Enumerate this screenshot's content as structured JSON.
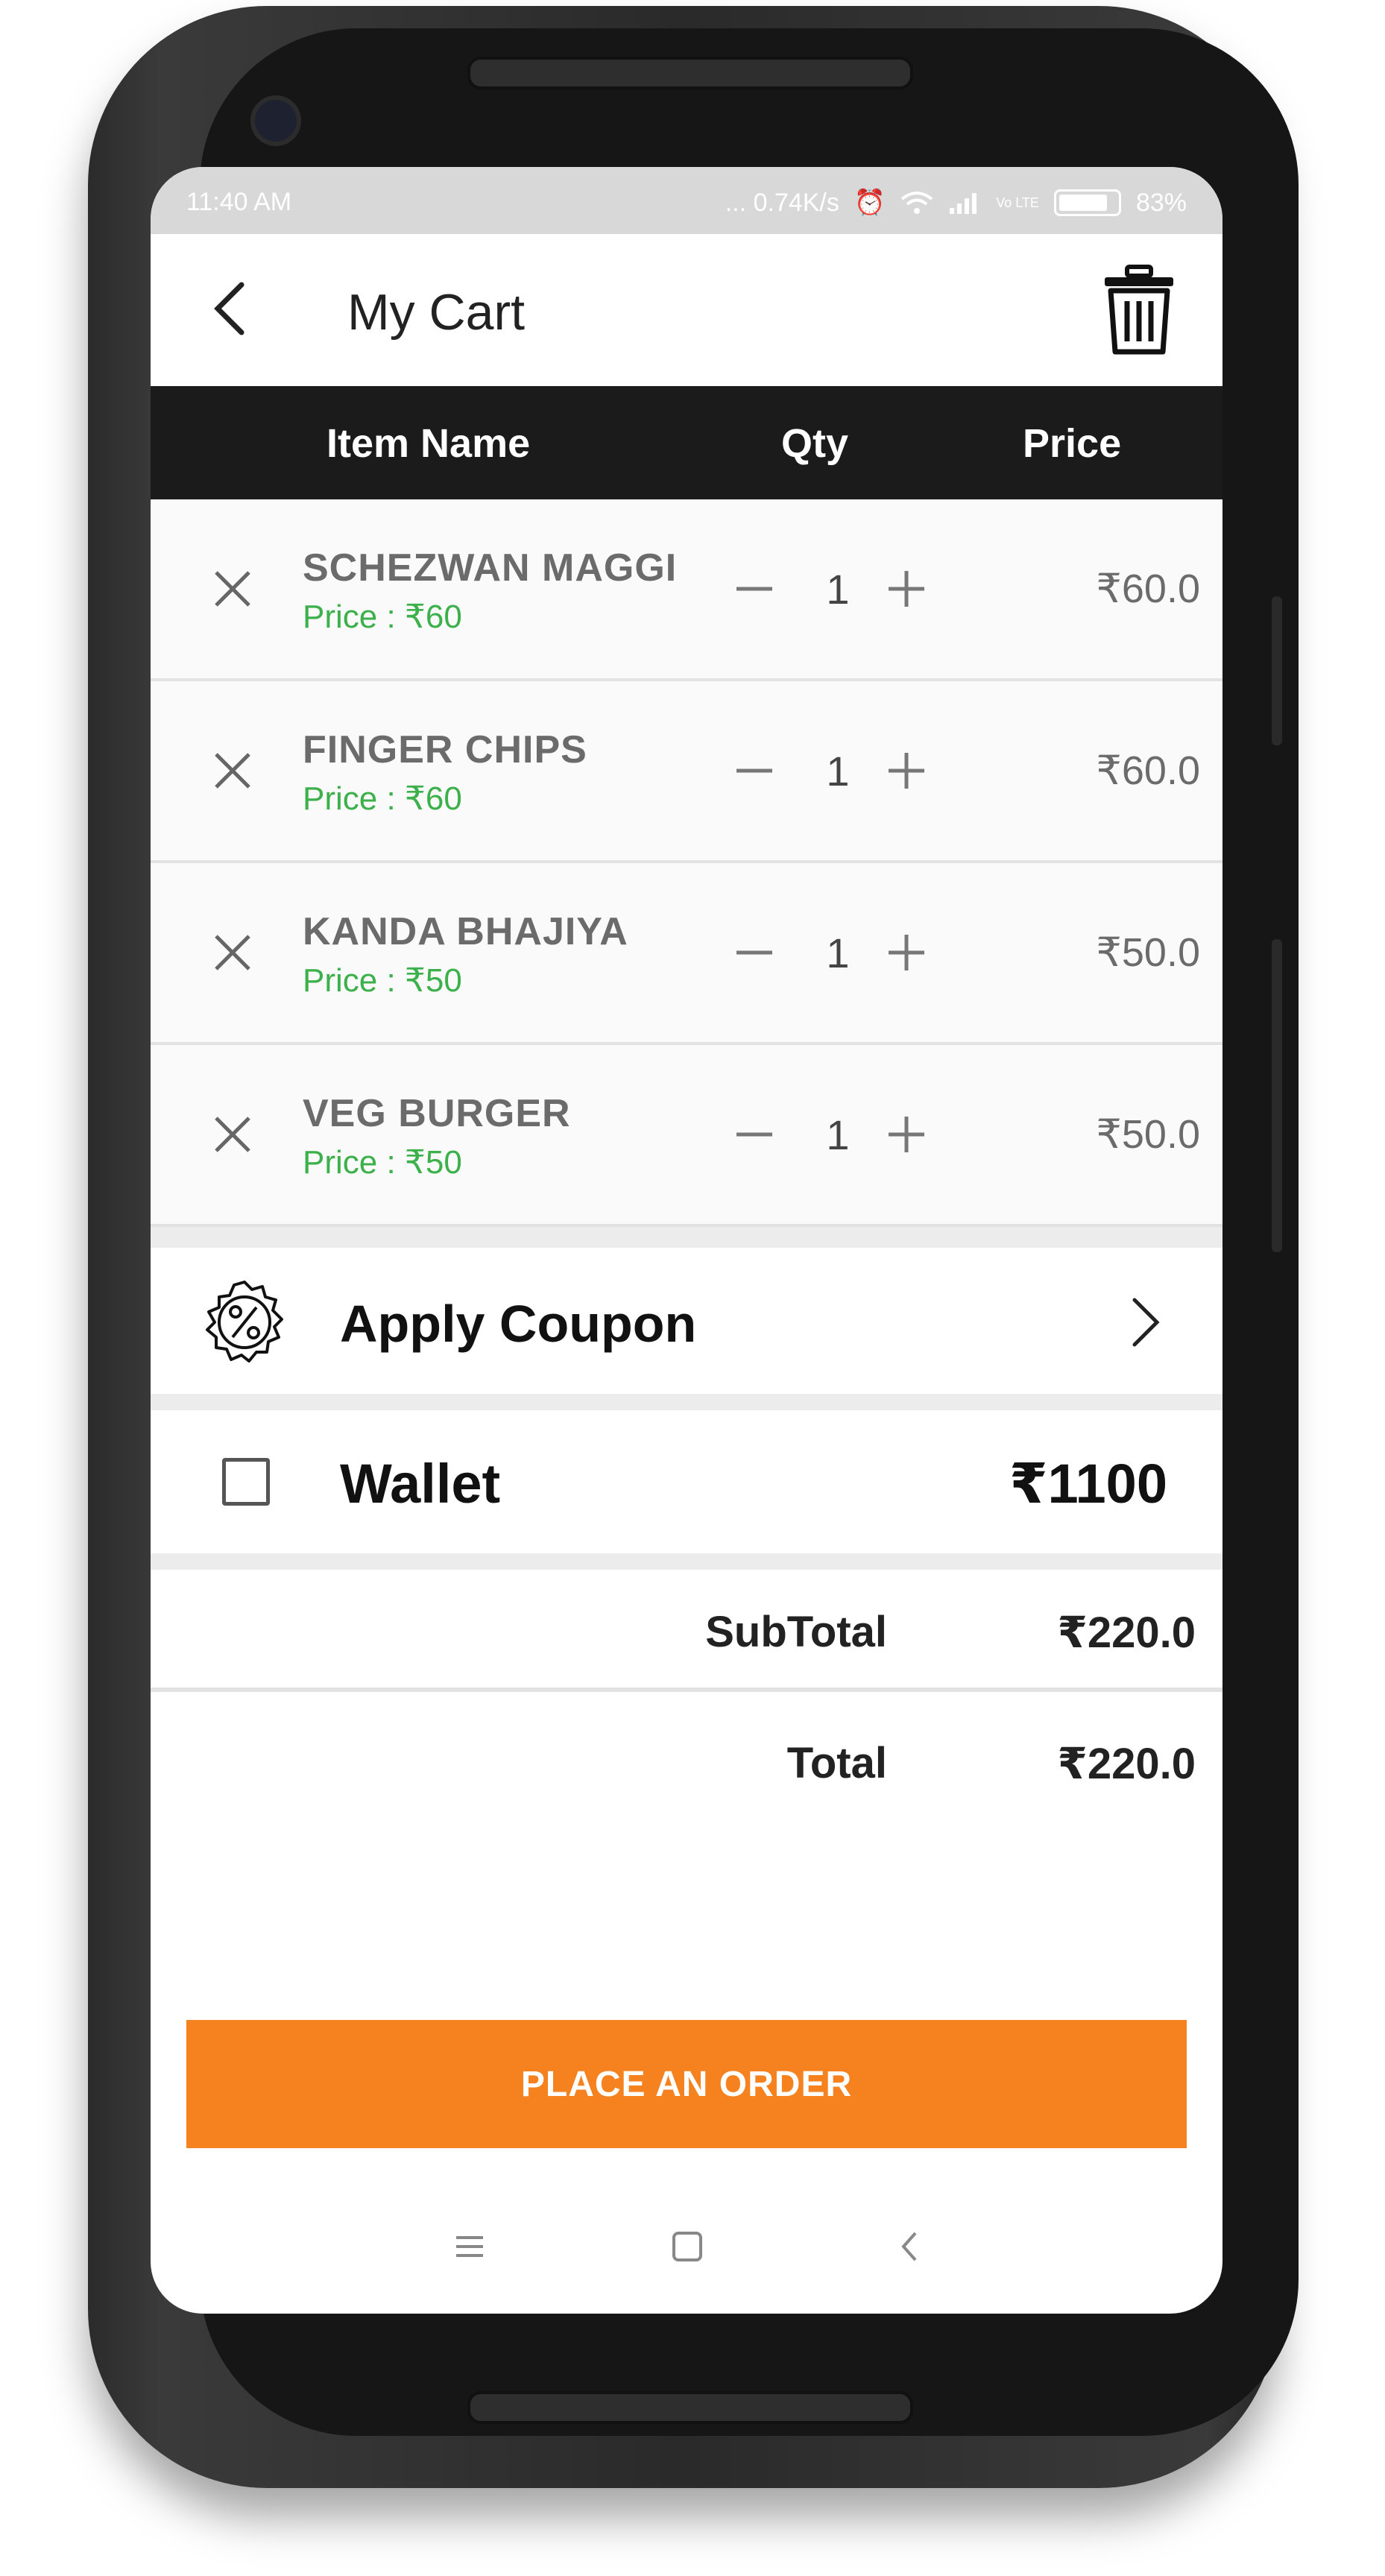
{
  "status_bar": {
    "time": "11:40 AM",
    "network_speed": "... 0.74K/s",
    "network_type": "Vo LTE",
    "battery": "83%"
  },
  "header": {
    "title": "My Cart",
    "back_icon": "chevron-left-icon",
    "clear_icon": "trash-icon"
  },
  "table": {
    "col_item": "Item Name",
    "col_qty": "Qty",
    "col_price": "Price"
  },
  "items": [
    {
      "name": "SCHEZWAN MAGGI",
      "unit_price": "Price : ₹60",
      "qty": "1",
      "total": "₹60.0"
    },
    {
      "name": "FINGER CHIPS",
      "unit_price": "Price : ₹60",
      "qty": "1",
      "total": "₹60.0"
    },
    {
      "name": "KANDA BHAJIYA",
      "unit_price": "Price : ₹50",
      "qty": "1",
      "total": "₹50.0"
    },
    {
      "name": "VEG BURGER",
      "unit_price": "Price : ₹50",
      "qty": "1",
      "total": "₹50.0"
    }
  ],
  "coupon": {
    "label": "Apply Coupon",
    "icon": "discount-badge-icon"
  },
  "wallet": {
    "label": "Wallet",
    "amount": "₹1100",
    "checked": false
  },
  "summary": {
    "subtotal_label": "SubTotal",
    "subtotal_value": "₹220.0",
    "total_label": "Total",
    "total_value": "₹220.0"
  },
  "order_button": {
    "label": "PLACE AN ORDER"
  },
  "colors": {
    "accent": "#f5821f",
    "price_green": "#3cb04a",
    "table_header": "#1b1b1b"
  }
}
